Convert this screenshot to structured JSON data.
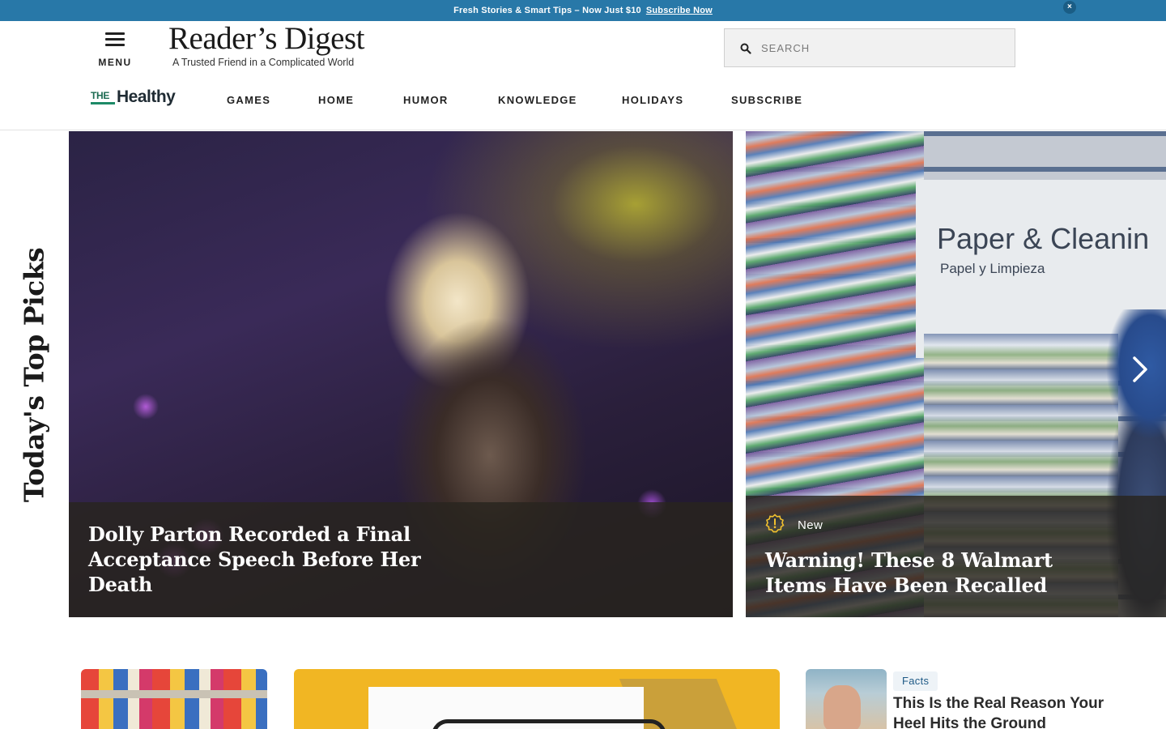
{
  "promo": {
    "text": "Fresh Stories & Smart Tips – Now Just $10",
    "link": "Subscribe Now",
    "close_icon": "×"
  },
  "header": {
    "menu_label": "MENU",
    "logo_text": "Reader’s Digest",
    "tagline": "A Trusted Friend in a Complicated World",
    "search_placeholder": "SEARCH"
  },
  "nav": {
    "brand": {
      "prefix": "THE",
      "name": "Healthy"
    },
    "items": [
      {
        "label": "GAMES"
      },
      {
        "label": "HOME"
      },
      {
        "label": "HUMOR"
      },
      {
        "label": "KNOWLEDGE"
      },
      {
        "label": "HOLIDAYS"
      },
      {
        "label": "SUBSCRIBE"
      }
    ]
  },
  "top_picks": {
    "section_title": "Today's Top Picks",
    "cards": [
      {
        "headline": "Dolly Parton Recorded a Final Acceptance Speech Before Her Death"
      },
      {
        "badge": "New",
        "headline": "Warning! These 8 Walmart Items Have Been Recalled",
        "image_text": "Paper & Cleanin",
        "image_subtext": "Papel y Limpieza"
      }
    ]
  },
  "more_stories": {
    "feature": {
      "tag": "Facts",
      "title": "This Is the Real Reason Your Heel Hits the Ground"
    }
  },
  "colors": {
    "promo_bg": "#2878a8",
    "healthy_green": "#1d8a67",
    "badge_yellow": "#f2c12e",
    "tag_bg": "#eef3f7",
    "tag_text": "#1f5a86"
  },
  "icons": [
    "menu-icon",
    "search-icon",
    "close-icon",
    "alert-badge-icon",
    "chevron-right-icon"
  ]
}
